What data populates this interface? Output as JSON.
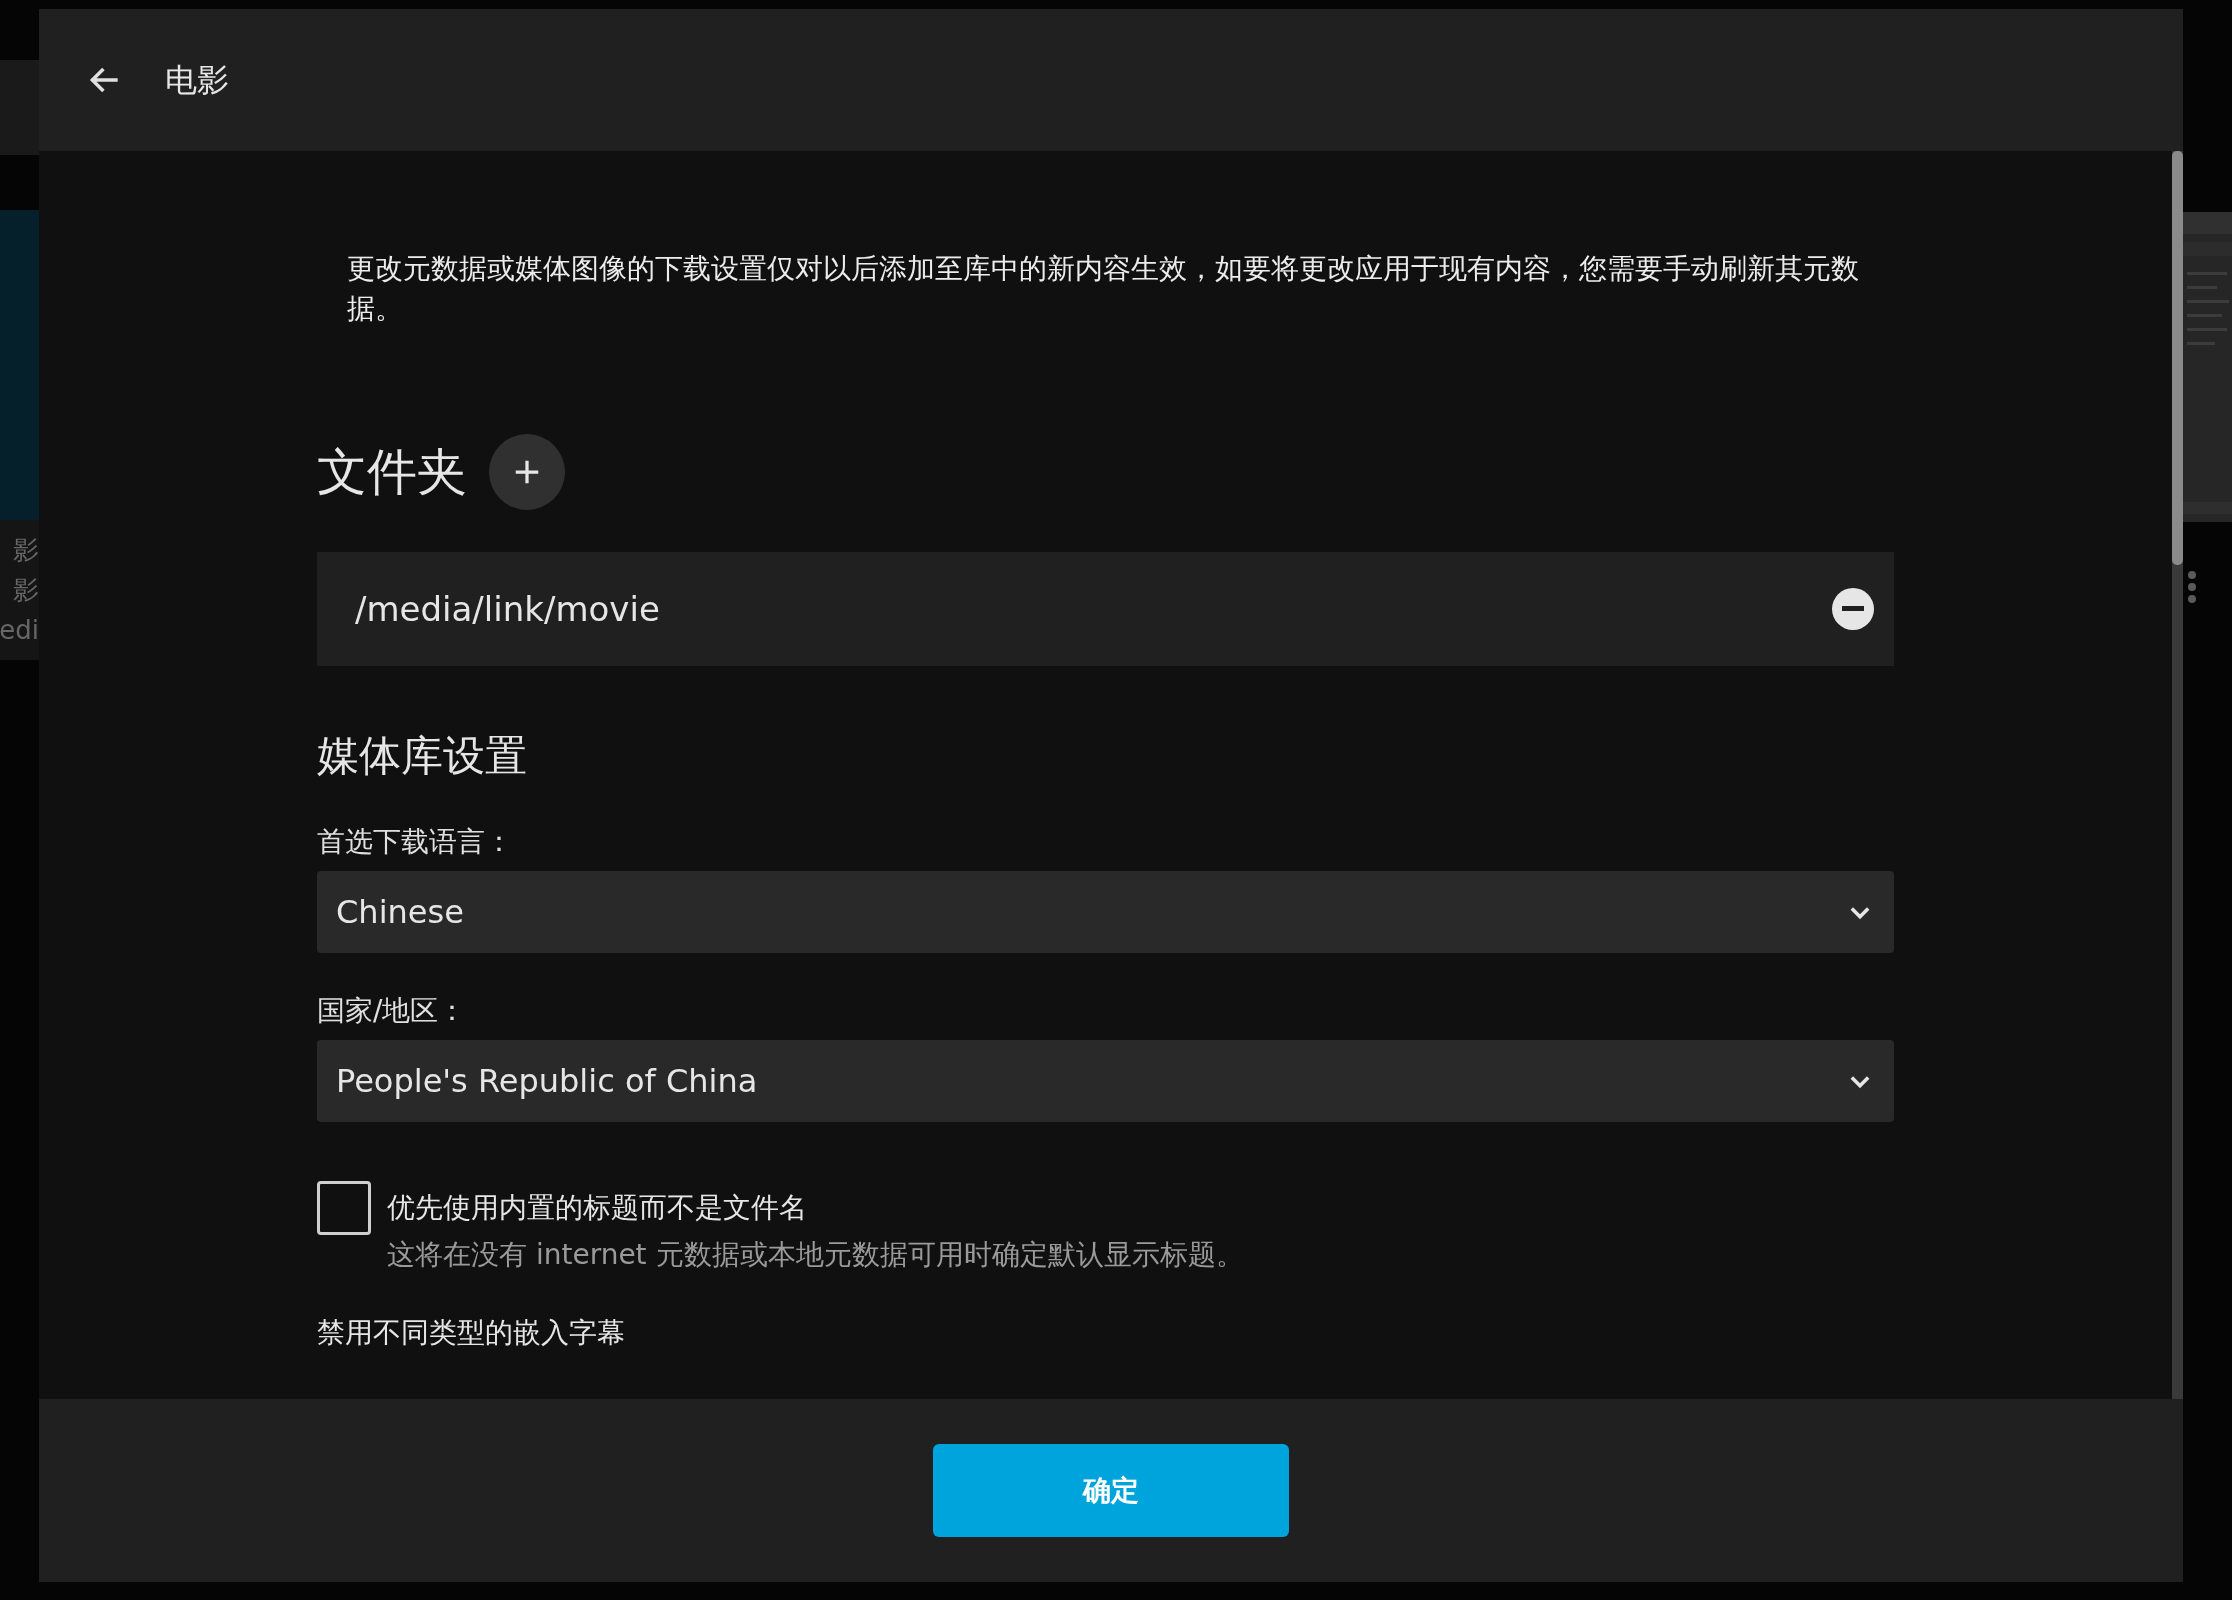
{
  "background": {
    "side_texts": [
      "影",
      "影",
      "edi"
    ]
  },
  "dialog": {
    "title": "电影",
    "notice": "更改元数据或媒体图像的下载设置仅对以后添加至库中的新内容生效，如要将更改应用于现有内容，您需要手动刷新其元数据。",
    "folders": {
      "heading": "文件夹",
      "items": [
        "/media/link/movie"
      ]
    },
    "settings": {
      "heading": "媒体库设置",
      "fields": [
        {
          "kind": "select",
          "label": "首选下载语言：",
          "value": "Chinese"
        },
        {
          "kind": "select",
          "label": "国家/地区：",
          "value": "People's Republic of China"
        },
        {
          "kind": "checkbox",
          "label": "优先使用内置的标题而不是文件名",
          "description": "这将在没有 internet 元数据或本地元数据可用时确定默认显示标题。",
          "checked": false
        },
        {
          "kind": "heading",
          "label": "禁用不同类型的嵌入字幕"
        }
      ]
    },
    "footer": {
      "button": "确定"
    }
  }
}
